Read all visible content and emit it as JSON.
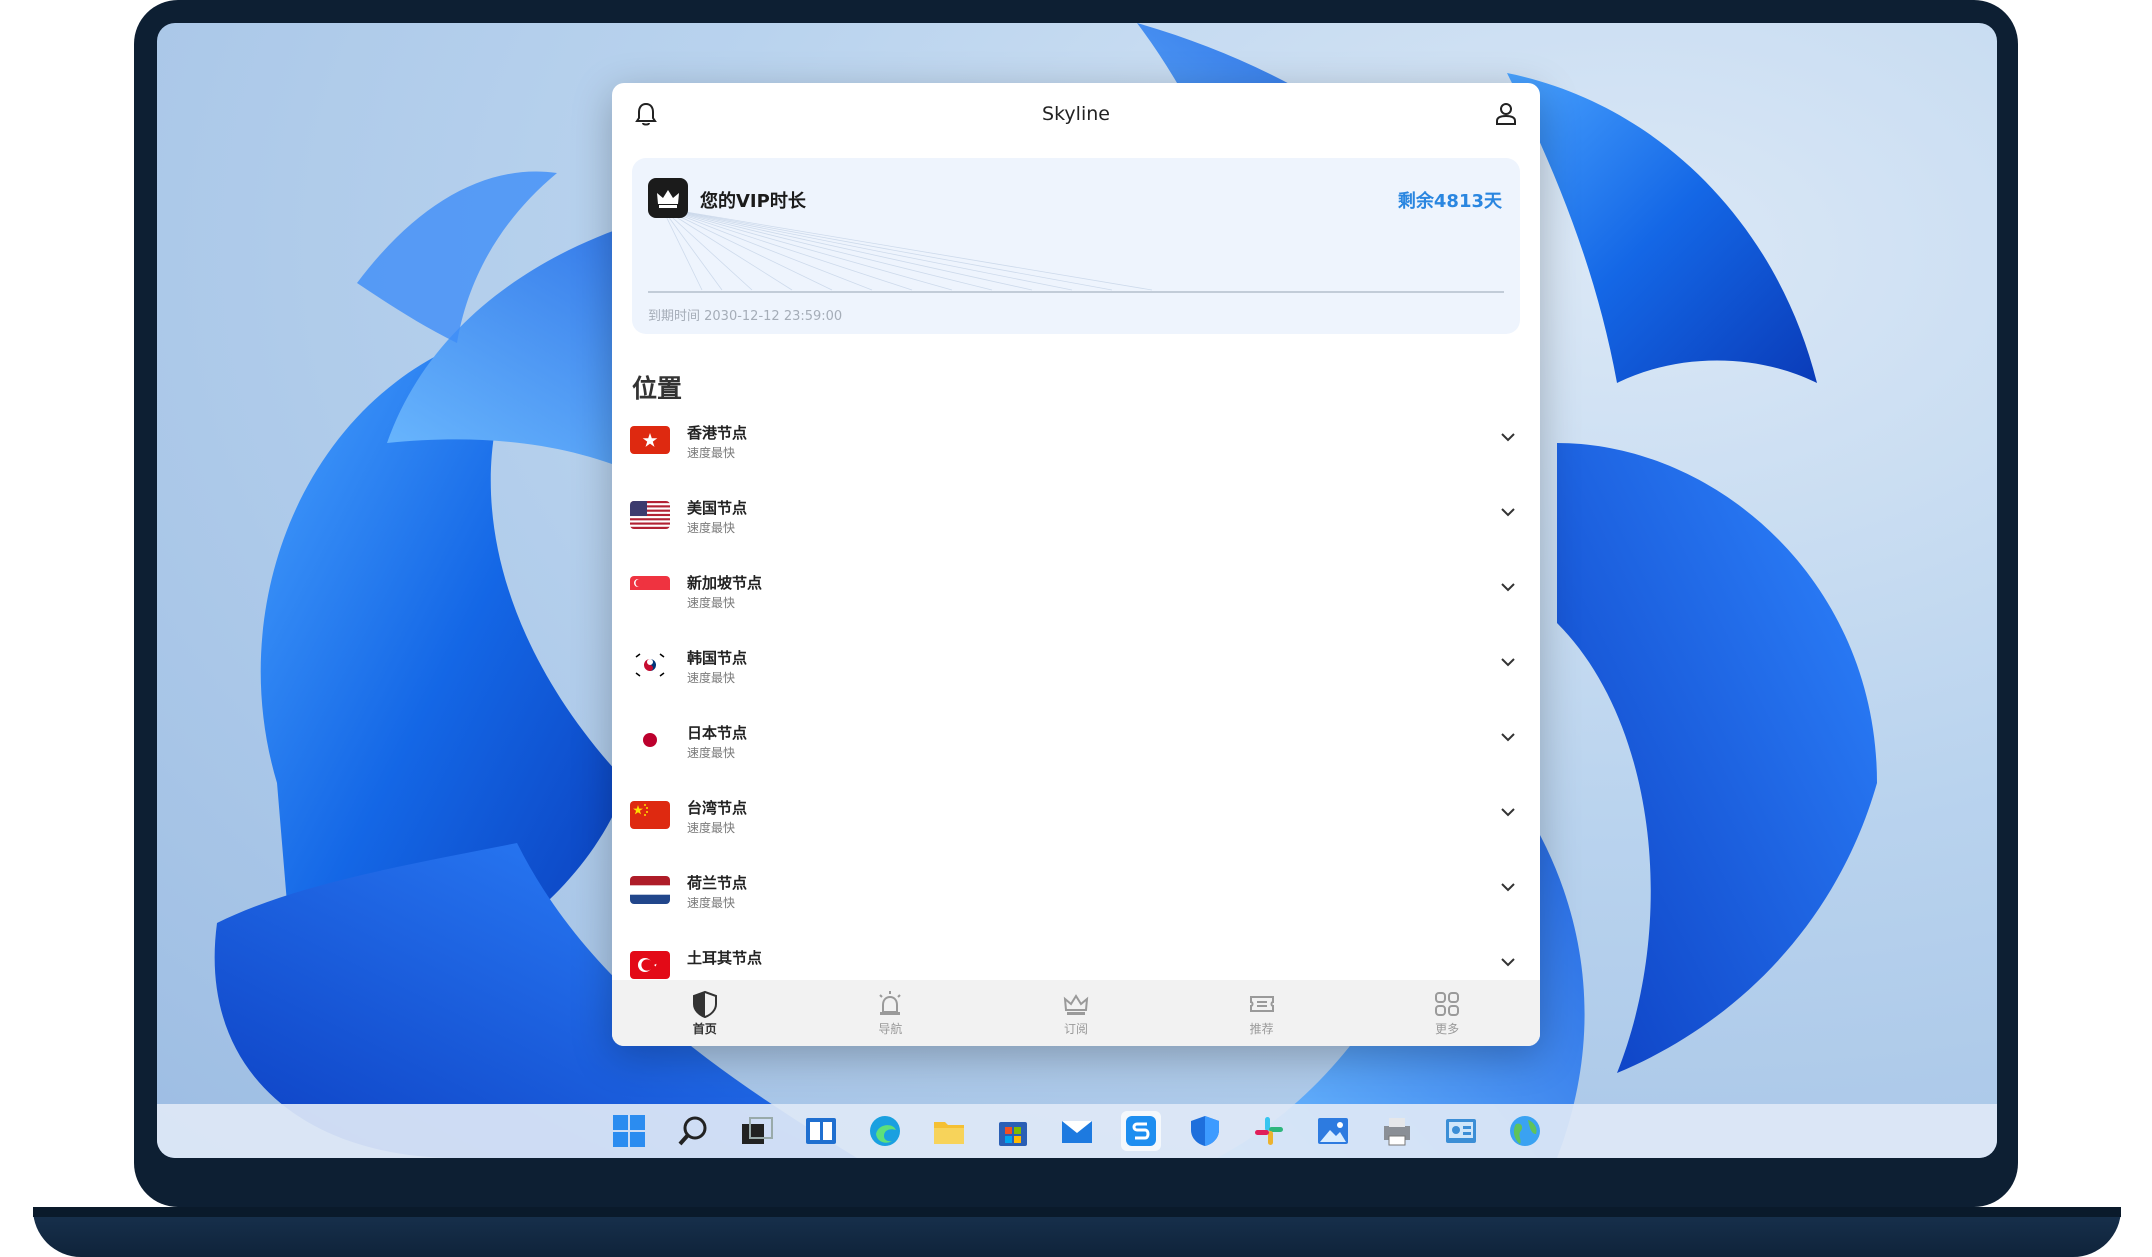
{
  "app": {
    "title": "Skyline"
  },
  "vip": {
    "label": "您的VIP时长",
    "remaining": "剩余4813天",
    "expire": "到期时间 2030-12-12 23:59:00"
  },
  "section": {
    "title": "位置"
  },
  "nodes": [
    {
      "name": "香港节点",
      "sub": "速度最快",
      "flag": "hk"
    },
    {
      "name": "美国节点",
      "sub": "速度最快",
      "flag": "us"
    },
    {
      "name": "新加坡节点",
      "sub": "速度最快",
      "flag": "sg"
    },
    {
      "name": "韩国节点",
      "sub": "速度最快",
      "flag": "kr"
    },
    {
      "name": "日本节点",
      "sub": "速度最快",
      "flag": "jp"
    },
    {
      "name": "台湾节点",
      "sub": "速度最快",
      "flag": "cn"
    },
    {
      "name": "荷兰节点",
      "sub": "速度最快",
      "flag": "nl"
    },
    {
      "name": "土耳其节点",
      "sub": "",
      "flag": "tr"
    }
  ],
  "nav": [
    {
      "label": "首页",
      "icon": "shield-icon",
      "active": true
    },
    {
      "label": "导航",
      "icon": "alarm-icon",
      "active": false
    },
    {
      "label": "订阅",
      "icon": "crown-icon",
      "active": false
    },
    {
      "label": "推荐",
      "icon": "ticket-icon",
      "active": false
    },
    {
      "label": "更多",
      "icon": "grid-icon",
      "active": false
    }
  ],
  "taskbar": [
    "windows-start-icon",
    "search-icon",
    "task-view-icon",
    "widgets-icon",
    "edge-icon",
    "file-explorer-icon",
    "store-icon",
    "mail-icon",
    "skyline-app-icon",
    "defender-icon",
    "slack-icon",
    "photos-icon",
    "printer-icon",
    "control-panel-icon",
    "globe-icon"
  ],
  "colors": {
    "accent": "#2a86e0",
    "bezel": "#0d1f33"
  }
}
